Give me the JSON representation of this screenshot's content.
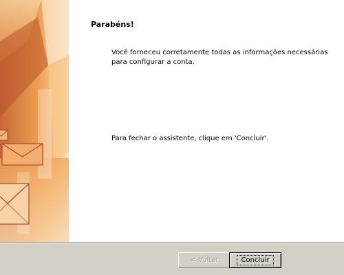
{
  "wizard": {
    "title": "Parabéns!",
    "message_line1": "Você forneceu corretamente todas as informações necessárias",
    "message_line2": "para configurar a conta.",
    "instruction": "Para fechar o assistente, clique em 'Concluir'."
  },
  "footer": {
    "back_label": "< Voltar",
    "finish_label": "Concluir",
    "back_enabled": false
  },
  "side_art": {
    "icon": "envelope-icon",
    "colors": {
      "dark": "#b8542a",
      "mid": "#e9964a",
      "light": "#f6c98a",
      "pale": "#fbeedc"
    }
  }
}
